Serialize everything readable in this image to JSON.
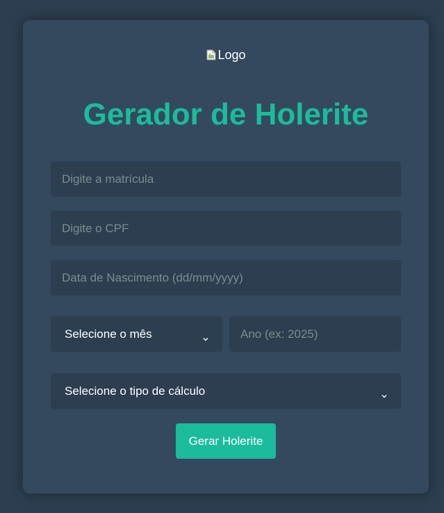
{
  "logo": {
    "alt_text": "Logo",
    "icon": "broken-image-icon"
  },
  "title": "Gerador de Holerite",
  "form": {
    "matricula_placeholder": "Digite a matrícula",
    "cpf_placeholder": "Digite o CPF",
    "nascimento_placeholder": "Data de Nascimento (dd/mm/yyyy)",
    "mes_selected": "Selecione o mês",
    "ano_placeholder": "Ano (ex: 2025)",
    "tipo_calculo_selected": "Selecione o tipo de cálculo",
    "submit_label": "Gerar Holerite"
  },
  "colors": {
    "page_background": "#2c3e50",
    "card_background": "#34495e",
    "field_background": "#2c3e50",
    "accent": "#1abc9c",
    "placeholder_text": "#7f8c8d",
    "text": "#ffffff"
  },
  "icons": {
    "select_arrow": "chevron-down-icon"
  }
}
